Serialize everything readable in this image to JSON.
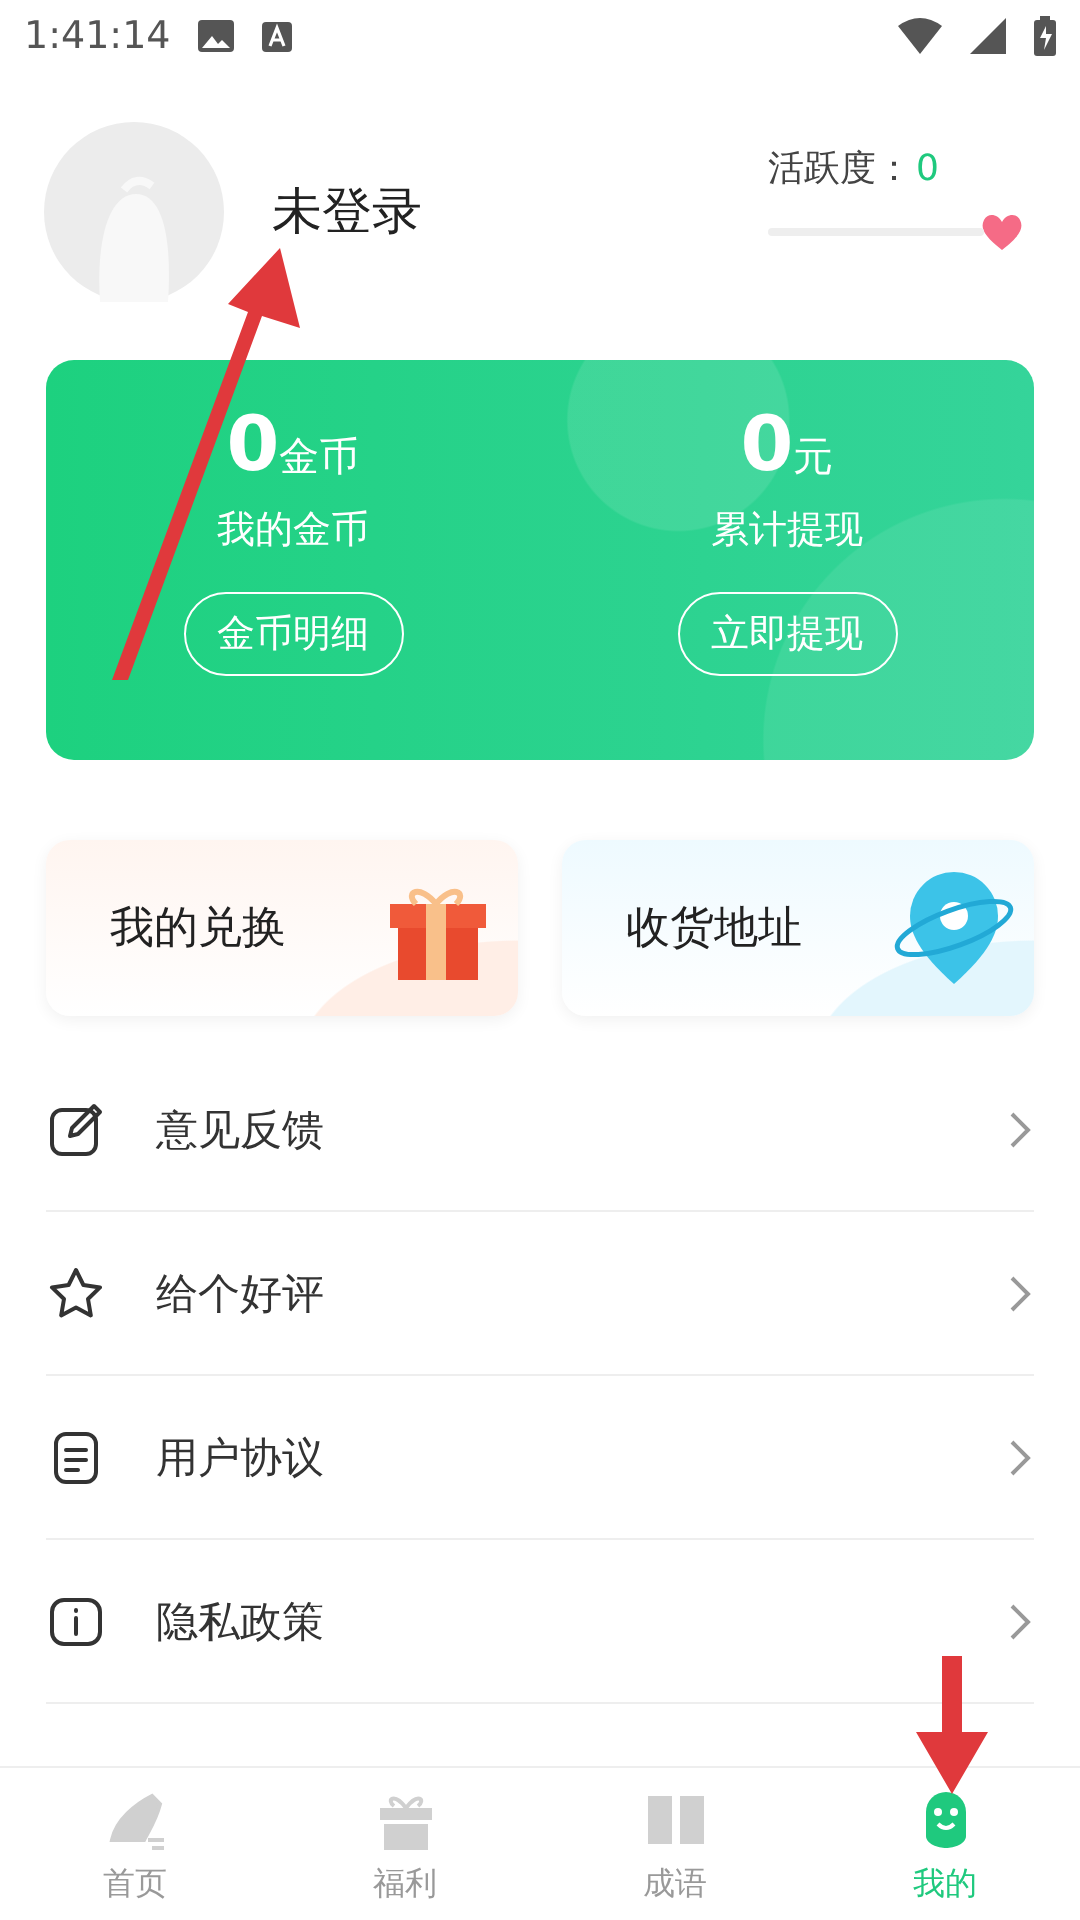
{
  "status_bar": {
    "time": "1:41:14"
  },
  "profile": {
    "name": "未登录",
    "activity_label": "活跃度：",
    "activity_value": "0"
  },
  "wallet": [
    {
      "amount": "0",
      "unit": "金币",
      "label": "我的金币",
      "button": "金币明细"
    },
    {
      "amount": "0",
      "unit": "元",
      "label": "累计提现",
      "button": "立即提现"
    }
  ],
  "shortcuts": [
    {
      "label": "我的兑换"
    },
    {
      "label": "收货地址"
    }
  ],
  "menu": [
    {
      "label": "意见反馈"
    },
    {
      "label": "给个好评"
    },
    {
      "label": "用户协议"
    },
    {
      "label": "隐私政策"
    }
  ],
  "tabs": [
    {
      "label": "首页",
      "selected": false
    },
    {
      "label": "福利",
      "selected": false
    },
    {
      "label": "成语",
      "selected": false
    },
    {
      "label": "我的",
      "selected": true
    }
  ]
}
